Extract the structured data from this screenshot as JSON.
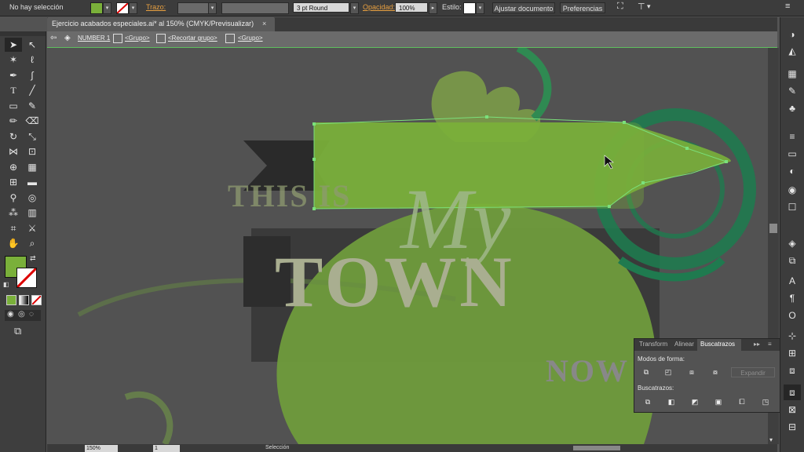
{
  "control_bar": {
    "selection_status": "No hay selección",
    "stroke_label": "Trazo:",
    "brush_label": "3 pt Round",
    "opacity_label": "Opacidad:",
    "opacity_value": "100%",
    "style_label": "Estilo:",
    "fit_document_button": "Ajustar documento",
    "preferences_button": "Preferencias",
    "fill_color": "#7ab03a"
  },
  "document_tab": {
    "title": "Ejercicio acabados especiales.ai* al 150% (CMYK/Previsualizar)",
    "close": "×"
  },
  "isolation_bar": {
    "layer": "NUMBER 1",
    "items": [
      "<Grupo>",
      "<Recortar grupo>",
      "<Grupo>"
    ]
  },
  "artwork": {
    "line1": "THIS IS",
    "script_word": "My",
    "main_word": "TOWN",
    "sub_word": "NOW"
  },
  "pathfinder_panel": {
    "tabs": [
      "Transform",
      "Alinear",
      "Buscatrazos"
    ],
    "active_tab": "Buscatrazos",
    "shape_modes_label": "Modos de forma:",
    "expand_button": "Expandir",
    "pathfinders_label": "Buscatrazos:"
  },
  "status_bar": {
    "zoom": "150%",
    "artboard": "1",
    "tool": "Selección"
  }
}
